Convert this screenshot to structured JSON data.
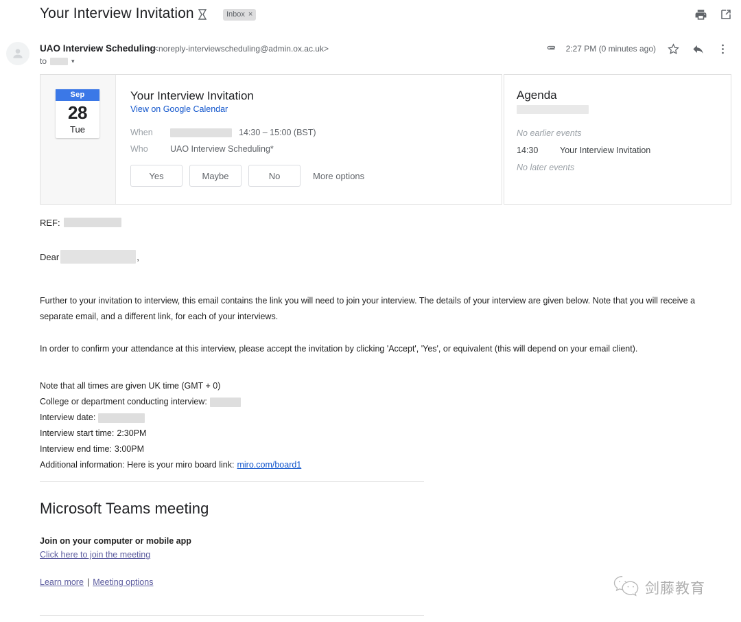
{
  "header": {
    "subject": "Your Interview Invitation",
    "important_marker_icon": "important-marker-icon",
    "label": "Inbox",
    "label_close": "×",
    "print_icon": "print-icon",
    "popout_icon": "open-in-new-window-icon"
  },
  "sender": {
    "name": "UAO Interview Scheduling",
    "email": "<noreply-interviewscheduling@admin.ox.ac.uk>",
    "to_prefix": "to",
    "to_caret": "▾",
    "attachment_icon": "paperclip-icon",
    "timestamp": "2:27 PM (0 minutes ago)",
    "star_icon": "star-icon",
    "reply_icon": "reply-icon",
    "more_icon": "more-vertical-icon"
  },
  "invite": {
    "date_chip": {
      "month": "Sep",
      "day": "28",
      "weekday": "Tue"
    },
    "title": "Your Interview Invitation",
    "calendar_link": "View on Google Calendar",
    "when_label": "When",
    "when_value": "14:30 – 15:00 (BST)",
    "who_label": "Who",
    "who_value": "UAO Interview Scheduling*",
    "buttons": [
      "Yes",
      "Maybe",
      "No"
    ],
    "more_options": "More options"
  },
  "agenda": {
    "title": "Agenda",
    "no_earlier": "No earlier events",
    "event_time": "14:30",
    "event_title": "Your Interview Invitation",
    "no_later": "No later events"
  },
  "body": {
    "ref_label": "REF:",
    "dear_label": "Dear",
    "dear_comma": ",",
    "paragraph_1": "Further to your invitation to interview, this email contains the link you will need to join your interview. The details of your interview are given below. Note that you will receive a separate email, and a different link, for each of your interviews.",
    "paragraph_2": "In order to confirm your attendance at this interview, please accept the invitation by clicking 'Accept', 'Yes', or equivalent (this will depend on your email client).",
    "details": {
      "timezone_note": "Note that all times are given UK time (GMT + 0)",
      "college_label": "College or department conducting interview:",
      "date_label": "Interview date:",
      "start_label": "Interview start time:",
      "start_value": "2:30PM",
      "end_label": "Interview end time:",
      "end_value": "3:00PM",
      "additional_label": "Additional information: Here is your miro board link:",
      "miro_link": "miro.com/board1"
    }
  },
  "teams": {
    "title": "Microsoft Teams meeting",
    "join_heading": "Join on your computer or mobile app",
    "join_link": "Click here to join the meeting",
    "learn_more": "Learn more",
    "separator": "|",
    "meeting_options": "Meeting options"
  },
  "watermark": {
    "text": "剑藤教育",
    "icon": "wechat-icon"
  },
  "colors": {
    "accent_blue": "#3b78e7",
    "link_blue": "#1155cc",
    "teams_link": "#5b5b9e",
    "muted": "#5f6368"
  }
}
